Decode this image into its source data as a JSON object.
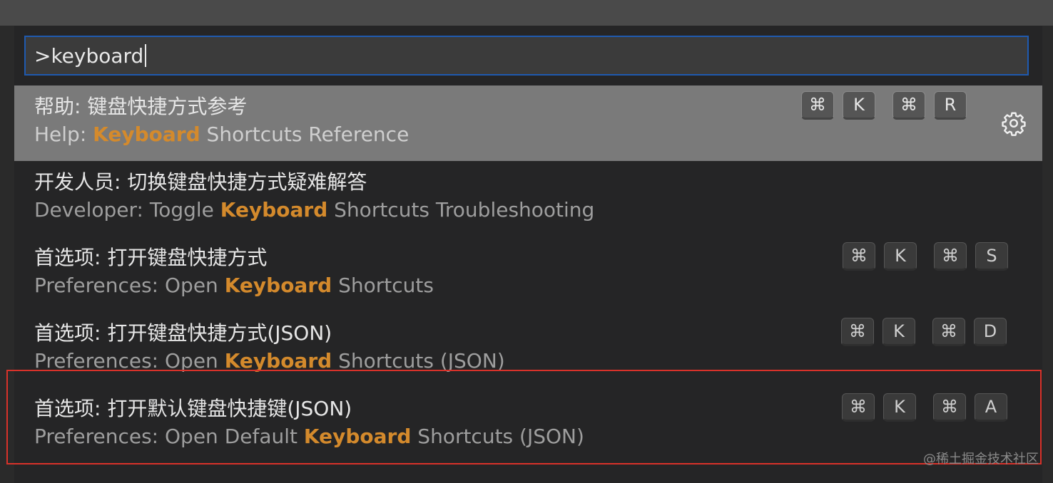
{
  "search": {
    "value": ">keyboard"
  },
  "commands": [
    {
      "title_zh": "帮助: 键盘快捷方式参考",
      "subtitle_prefix": "Help: ",
      "subtitle_highlight": "Keyboard",
      "subtitle_suffix": " Shortcuts Reference",
      "keys": [
        "⌘",
        "K",
        "⌘",
        "R"
      ],
      "selected": true
    },
    {
      "title_zh": "开发人员: 切换键盘快捷方式疑难解答",
      "subtitle_prefix": "Developer: Toggle ",
      "subtitle_highlight": "Keyboard",
      "subtitle_suffix": " Shortcuts Troubleshooting",
      "keys": []
    },
    {
      "title_zh": "首选项: 打开键盘快捷方式",
      "subtitle_prefix": "Preferences: Open ",
      "subtitle_highlight": "Keyboard",
      "subtitle_suffix": " Shortcuts",
      "keys": [
        "⌘",
        "K",
        "⌘",
        "S"
      ]
    },
    {
      "title_zh": "首选项: 打开键盘快捷方式(JSON)",
      "subtitle_prefix": "Preferences: Open ",
      "subtitle_highlight": "Keyboard",
      "subtitle_suffix": " Shortcuts (JSON)",
      "keys": [
        "⌘",
        "K",
        "⌘",
        "D"
      ]
    },
    {
      "title_zh": "首选项: 打开默认键盘快捷键(JSON)",
      "subtitle_prefix": "Preferences: Open Default ",
      "subtitle_highlight": "Keyboard",
      "subtitle_suffix": " Shortcuts (JSON)",
      "keys": [
        "⌘",
        "K",
        "⌘",
        "A"
      ]
    }
  ],
  "icons": {
    "selected_action": "gear-icon"
  },
  "colors": {
    "highlight": "#d48a2c",
    "annotation_box": "#d9322a",
    "input_border": "#1f5ab0"
  },
  "watermark": "@稀土掘金技术社区"
}
